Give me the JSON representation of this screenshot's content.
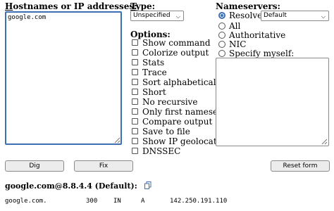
{
  "hostnames": {
    "label_underlined": "H",
    "label_rest": "ostnames or IP addresses:",
    "value": "google.com"
  },
  "type": {
    "label_underlined": "T",
    "label_rest": "ype:",
    "selected": "Unspecified"
  },
  "options": {
    "label": "Options:",
    "items": [
      {
        "label": "Show command",
        "checked": false
      },
      {
        "label": "Colorize output",
        "checked": false
      },
      {
        "label": "Stats",
        "checked": false
      },
      {
        "label": "Trace",
        "checked": false
      },
      {
        "label": "Sort alphabetically",
        "checked": false
      },
      {
        "label": "Short",
        "checked": false
      },
      {
        "label": "No recursive",
        "checked": false
      },
      {
        "label": "Only first nameserver",
        "checked": false
      },
      {
        "label": "Compare output",
        "checked": false
      },
      {
        "label": "Save to file",
        "checked": false
      },
      {
        "label": "Show IP geolocation",
        "checked": false
      },
      {
        "label": "DNSSEC",
        "checked": false
      }
    ]
  },
  "nameservers": {
    "label": "Nameservers:",
    "resolver_label": "Resolver:",
    "resolver_selected": "Default",
    "radios": [
      {
        "label": "All"
      },
      {
        "label": "Authoritative"
      },
      {
        "label": "NIC"
      },
      {
        "label": "Specify myself:"
      }
    ]
  },
  "buttons": {
    "dig": "Dig",
    "fix": "Fix",
    "reset": "Reset form"
  },
  "result": {
    "title": "google.com@8.8.4.4 (Default):",
    "record": {
      "name": "google.com.",
      "ttl": "300",
      "class": "IN",
      "type": "A",
      "address": "142.250.191.110"
    }
  },
  "colors": {
    "focus_border": "#3d6fb3",
    "button_bg": "#ececec"
  }
}
